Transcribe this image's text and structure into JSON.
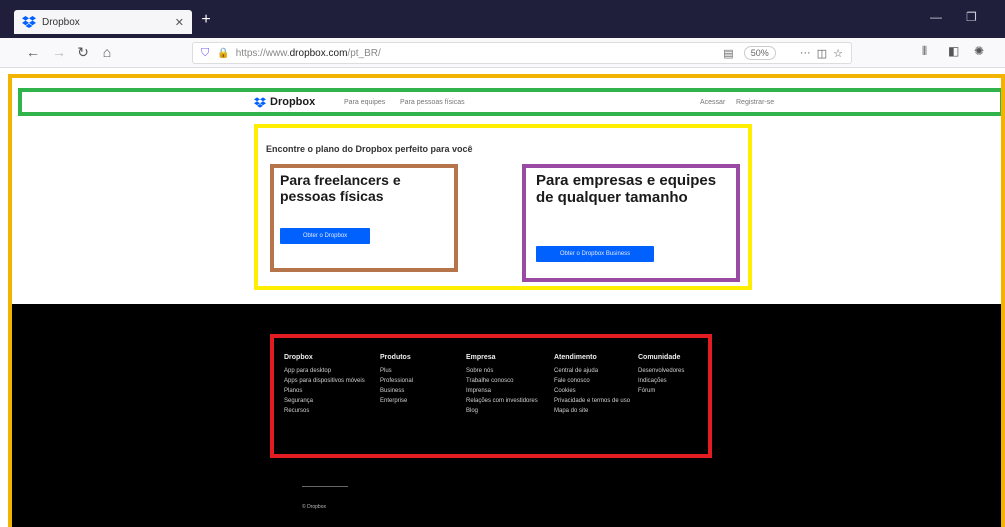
{
  "browser": {
    "tab_title": "Dropbox",
    "tab_close": "✕",
    "new_tab": "+",
    "minimize": "—",
    "maximize": "❐",
    "url_prefix": "https://www.",
    "url_domain": "dropbox.com",
    "url_path": "/pt_BR/",
    "zoom": "50%"
  },
  "site": {
    "logo_text": "Dropbox",
    "nav_left": [
      "Para equipes",
      "Para pessoas físicas"
    ],
    "nav_right": [
      "Acessar",
      "Registrar-se"
    ]
  },
  "plans": {
    "headline": "Encontre o plano do Dropbox perfeito para você",
    "personal_title": "Para freelancers e pessoas físicas",
    "personal_cta": "Obter o Dropbox",
    "business_title": "Para empresas e equipes de qualquer tamanho",
    "business_cta": "Obter o Dropbox Business"
  },
  "footer": {
    "columns": [
      {
        "title": "Dropbox",
        "items": [
          "App para desktop",
          "Apps para dispositivos móveis",
          "Planos",
          "Segurança",
          "Recursos"
        ]
      },
      {
        "title": "Produtos",
        "items": [
          "Plus",
          "Professional",
          "Business",
          "Enterprise"
        ]
      },
      {
        "title": "Empresa",
        "items": [
          "Sobre nós",
          "Trabalhe conosco",
          "Imprensa",
          "Relações com investidores",
          "Blog"
        ]
      },
      {
        "title": "Atendimento",
        "items": [
          "Central de ajuda",
          "Fale conosco",
          "Cookies",
          "Privacidade e termos de uso",
          "Mapa do site"
        ]
      },
      {
        "title": "Comunidade",
        "items": [
          "Desenvolvedores",
          "Indicações",
          "Fórum"
        ]
      }
    ],
    "copyright": "© Dropbox"
  }
}
